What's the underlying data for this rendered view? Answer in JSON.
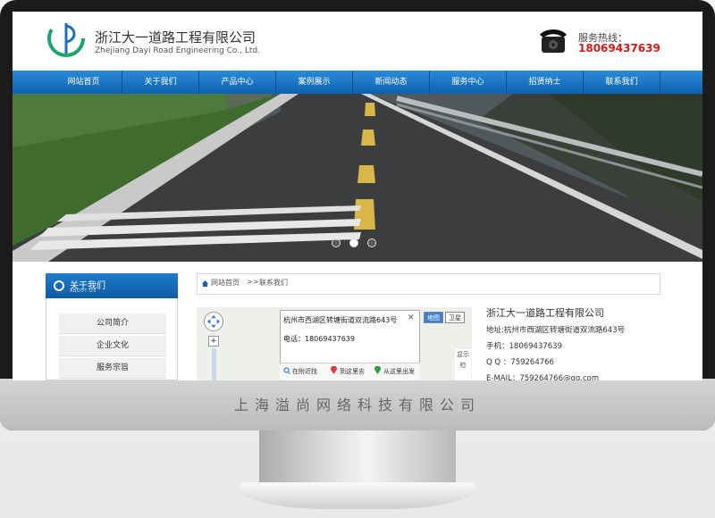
{
  "company": {
    "cn_name": "浙江大一道路工程有限公司",
    "en_name": "Zhejiang Dayi Road Engineering Co., Ltd."
  },
  "hotline": {
    "label": "服务热线：",
    "number": "18069437639"
  },
  "nav": [
    "网站首页",
    "关于我们",
    "产品中心",
    "案例展示",
    "新闻动态",
    "服务中心",
    "招贤纳士",
    "联系我们"
  ],
  "banner": {
    "slides": 3,
    "active_slide": 2
  },
  "sidebar": {
    "title_cn": "关于我们",
    "title_en": "ABOUT US",
    "items": [
      "公司简介",
      "企业文化",
      "服务宗旨"
    ]
  },
  "breadcrumb": {
    "home": "网站首页",
    "separator": ">>",
    "current": "联系我们"
  },
  "map": {
    "popup_address": "杭州市西湖区转塘街道双流路643号",
    "popup_tel": "电话：18069437639",
    "close": "✕",
    "links": [
      "在附近找",
      "到这里去",
      "从这里出发"
    ],
    "type_map": "地图",
    "type_satellite": "卫星",
    "side_label": "显示检"
  },
  "contact": {
    "title": "浙江大一道路工程有限公司",
    "address": "地址:杭州市西湖区转塘街道双流路643号",
    "mobile": "手机：18069437639",
    "qq": "Q Q ：759264766",
    "email": "E-MAIL：759264766@qq.com"
  },
  "monitor_caption": "上海溢尚网络科技有限公司",
  "colors": {
    "nav_blue": "#1a72c2",
    "hotline_red": "#d21a1a"
  }
}
